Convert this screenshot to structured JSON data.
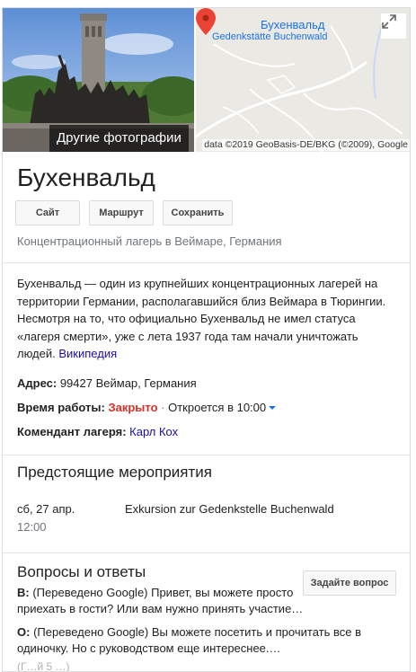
{
  "photos": {
    "more_label": "Другие фотографии"
  },
  "map": {
    "place_title": "Бухенвальд",
    "place_subtitle": "Gedenkstätte Buchenwald",
    "attribution": "data ©2019 GeoBasis-DE/BKG (©2009), Google",
    "pin_color": "#ea4335",
    "expand_icon": "expand-icon"
  },
  "title": "Бухенвальд",
  "actions": {
    "site": "Сайт",
    "route": "Маршрут",
    "save": "Сохранить"
  },
  "category": "Концентрационный лагерь в Веймаре, Германия",
  "description": {
    "text": "Бухенвальд — один из крупнейших концентрационных лагерей на территории Германии, располагавшийся близ Веймара в Тюрингии. Несмотря на то, что официально Бухенвальд не имел статуса «лагеря смерти», уже с лета 1937 года там начали уничтожать людей.",
    "source_link": "Википедия"
  },
  "info": {
    "address_label": "Адрес:",
    "address_value": "99427 Веймар, Германия",
    "hours_label": "Время работы:",
    "hours_status": "Закрыто",
    "hours_separator": "·",
    "hours_next": "Откроется в 10:00",
    "commandant_label": "Комендант лагеря:",
    "commandant_value": "Карл Кох"
  },
  "events": {
    "heading": "Предстоящие мероприятия",
    "items": [
      {
        "date": "сб, 27 апр.",
        "time": "12:00",
        "title": "Exkursion zur Gedenkstelle Buchenwald"
      }
    ]
  },
  "qa": {
    "heading": "Вопросы и ответы",
    "ask_button": "Задайте вопрос",
    "question_prefix": "В:",
    "question_text": "(Переведено Google) Привет, вы можете просто приехать в гости? Или вам нужно принять участие…",
    "answer_prefix": "О:",
    "answer_text": "(Переведено Google) Вы можете посетить и прочитать все в одиночку. Но с руководством еще интереснее.…",
    "faded_text": "(Г…й 5 …)"
  },
  "colors": {
    "link": "#1a0dab",
    "closed": "#d93025",
    "map_label": "#1a73e8"
  }
}
